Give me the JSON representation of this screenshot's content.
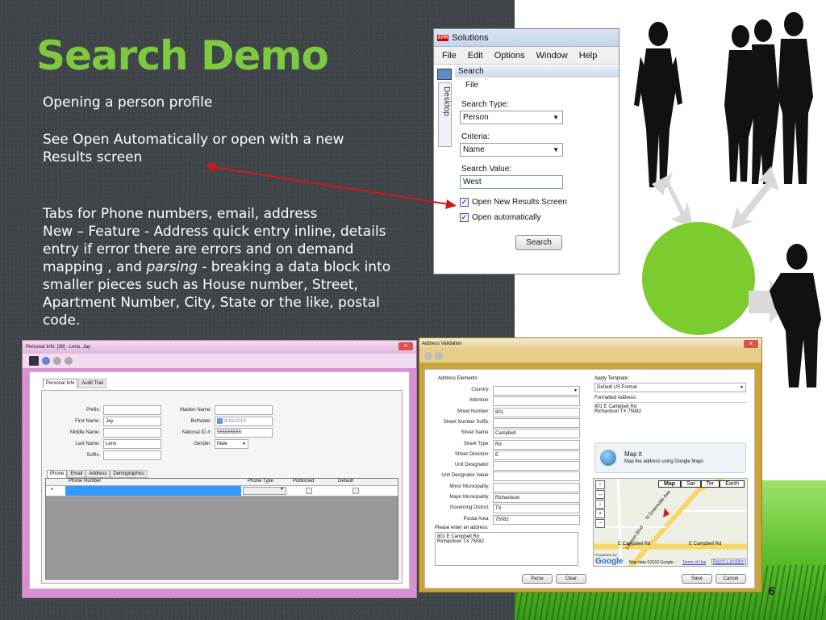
{
  "slide": {
    "title": "Search Demo",
    "line1": "Opening a person profile",
    "line2a": "See Open Automatically  or open with a new",
    "line2b": "Results screen",
    "para": [
      "Tabs for Phone numbers, email, address",
      "New – Feature - Address quick entry inline, details",
      "entry if error  there are errors and on demand",
      "smaller pieces such as House number, Street,",
      "Apartment Number, City, State or the like, postal",
      "code."
    ],
    "mapping_prefix": "mapping , and ",
    "mapping_italic": "parsing",
    "mapping_suffix": " - breaking a data block into",
    "page_number": "6"
  },
  "solutions": {
    "app_icon": "EPR",
    "title": "Solutions",
    "menu": [
      "File",
      "Edit",
      "Options",
      "Window",
      "Help"
    ],
    "side_tab": "Desktop",
    "panel_title": "Search",
    "file_label": "File",
    "search_type_label": "Search Type:",
    "search_type_value": "Person",
    "criteria_label": "Criteria:",
    "criteria_value": "Name",
    "search_value_label": "Search Value:",
    "search_value": "West",
    "chk1": "Open New Results Screen",
    "chk2": "Open automatically",
    "search_button": "Search"
  },
  "personal": {
    "title": "Personal Info: [36] - Leno, Jay",
    "tabs": [
      "Personal Info",
      "Audit Trail"
    ],
    "prefix_label": "Prefix:",
    "first_label": "First Name:",
    "first_value": "Jay",
    "middle_label": "Middle Name:",
    "last_label": "Last Name:",
    "last_value": "Leno",
    "suffix_label": "Suffix:",
    "maiden_label": "Maiden Name:",
    "birth_label": "Birthdate:",
    "birth_value": "8/16/2010",
    "natid_label": "National ID #:",
    "natid_value": "555555555",
    "gender_label": "Gender:",
    "gender_value": "Male",
    "subtabs": [
      "Phone",
      "Email",
      "Address",
      "Demographics"
    ],
    "grid_headers": [
      "Phone Number",
      "Phone Type",
      "Published",
      "Default"
    ],
    "new_row_marker": "*"
  },
  "address": {
    "title": "Address Validation",
    "elements_label": "Address Elements",
    "fields": [
      {
        "label": "Country:",
        "value": ""
      },
      {
        "label": "Attention:",
        "value": ""
      },
      {
        "label": "Street Number:",
        "value": "801"
      },
      {
        "label": "Street Number Suffix:",
        "value": ""
      },
      {
        "label": "Street Name:",
        "value": "Campbell"
      },
      {
        "label": "Street Type:",
        "value": "Rd"
      },
      {
        "label": "Street Direction:",
        "value": "E"
      },
      {
        "label": "Unit Designator:",
        "value": ""
      },
      {
        "label": "Unit Designator Value:",
        "value": ""
      },
      {
        "label": "Minor Municipality:",
        "value": ""
      },
      {
        "label": "Major Municipality:",
        "value": "Richardson"
      },
      {
        "label": "Governing District:",
        "value": "TX"
      },
      {
        "label": "Postal Area:",
        "value": "75082"
      }
    ],
    "enter_label": "Please enter an address:",
    "enter_line1": "801 E Campbell Rd",
    "enter_line2": "Richardson TX  75082",
    "template_label": "Apply Template:",
    "template_value": "Default US Format",
    "formatted_label": "Formatted Address:",
    "formatted_line1": "801 E Campbell Rd",
    "formatted_line2": "Richardson TX  75082",
    "mapit_title": "Map it",
    "mapit_desc": "Map the address using Google Maps",
    "map_tabs": [
      "Map",
      "Sat",
      "Ter",
      "Earth"
    ],
    "road1": "E Campbell Rd",
    "road2": "E Campbell Rd",
    "road3": "N Greenville Ave",
    "road4": "Lawson Blvd",
    "powered": "POWERED BY",
    "google": "Google",
    "mapdata": "Map data ©2010 Google -",
    "terms": "Terms of Use",
    "report": "Report a problem",
    "parse_button": "Parse",
    "clear_button": "Clear",
    "save_button": "Save",
    "cancel_button": "Cancel"
  },
  "colors": {
    "title_green": "#7ec940",
    "circle_green": "#7ccb2f",
    "arrow_red": "#d01818"
  }
}
